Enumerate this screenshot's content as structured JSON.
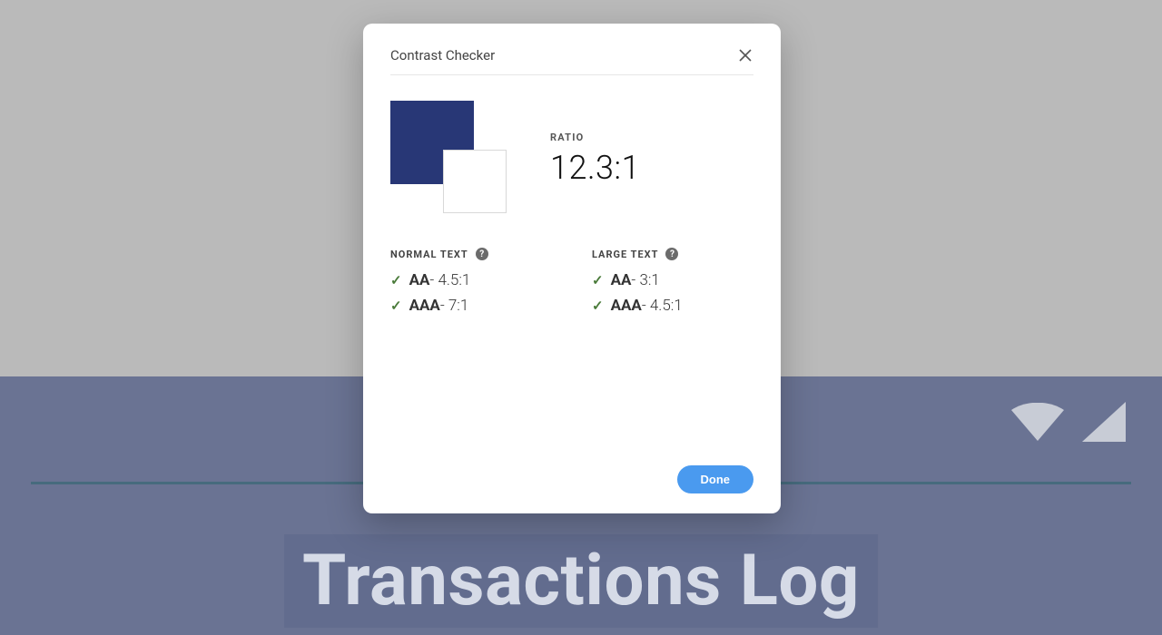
{
  "background": {
    "title": "Transactions Log"
  },
  "modal": {
    "title": "Contrast Checker",
    "ratio_label": "RATIO",
    "ratio_value": "12.3:1",
    "swatches": {
      "back_color": "#283776",
      "front_color": "#ffffff"
    },
    "columns": [
      {
        "header": "NORMAL TEXT",
        "results": [
          {
            "level": "AA",
            "requirement": "4.5:1",
            "pass": true
          },
          {
            "level": "AAA",
            "requirement": "7:1",
            "pass": true
          }
        ]
      },
      {
        "header": "LARGE TEXT",
        "results": [
          {
            "level": "AA",
            "requirement": "3:1",
            "pass": true
          },
          {
            "level": "AAA",
            "requirement": "4.5:1",
            "pass": true
          }
        ]
      }
    ],
    "done_label": "Done",
    "help_glyph": "?"
  }
}
